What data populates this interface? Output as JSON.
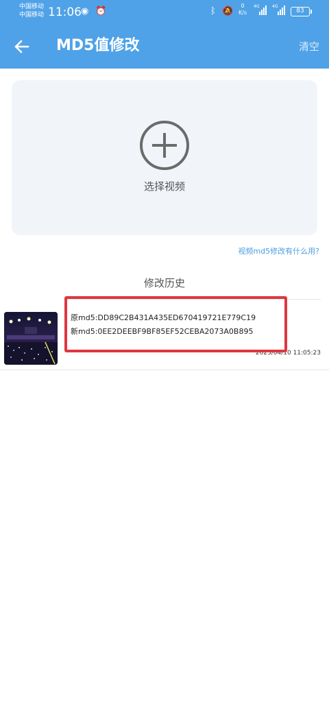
{
  "status_bar": {
    "carrier_1": "中国移动",
    "carrier_2": "中国移动",
    "time": "11:06",
    "net_speed_value": "0",
    "net_speed_unit": "K/s",
    "signal_1": "4G",
    "signal_2": "4G",
    "battery": "83"
  },
  "header": {
    "title": "MD5值修改",
    "clear_label": "清空",
    "bg_color": "#4fa2e7"
  },
  "picker": {
    "label": "选择视频"
  },
  "help_link": "视频md5修改有什么用?",
  "history": {
    "title": "修改历史",
    "items": [
      {
        "original_md5": "原md5:DD89C2B431A435ED670419721E779C19",
        "new_md5": "新md5:0EE2DEEBF9BF85EF52CEBA2073A0B895",
        "timestamp": "2023/04/10 11:05:23"
      }
    ]
  },
  "accent_colors": {
    "link": "#4a9ee0",
    "highlight_box": "#e0363f"
  }
}
